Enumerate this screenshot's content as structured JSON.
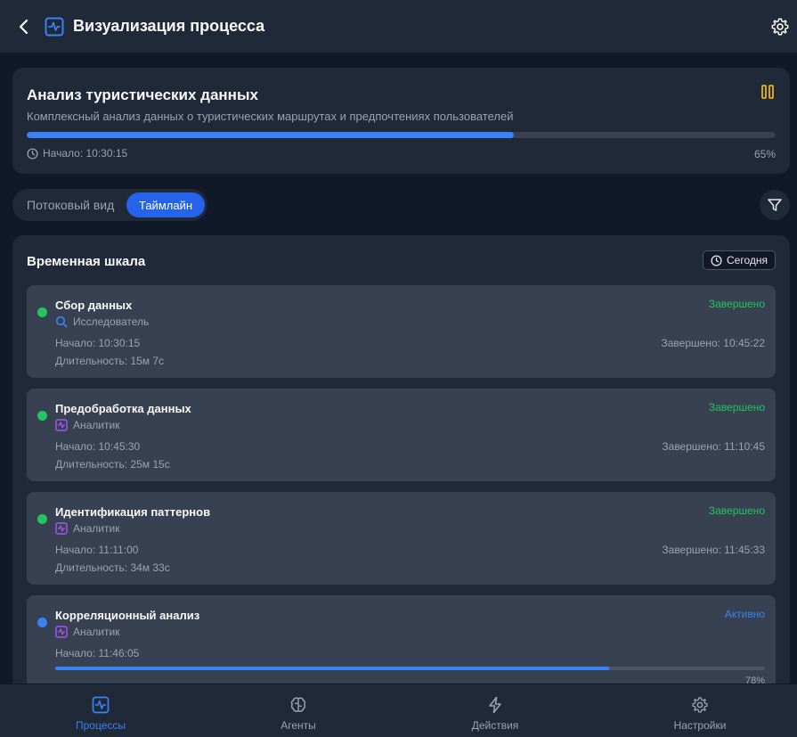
{
  "header": {
    "title": "Визуализация процесса"
  },
  "process": {
    "title": "Анализ туристических данных",
    "description": "Комплексный анализ данных о туристических маршрутах и предпочтениях пользователей",
    "progress": 0.65,
    "progress_label": "65%",
    "start_label": "Начало: 10:30:15"
  },
  "view_toggle": {
    "flow_label": "Потоковый вид",
    "timeline_label": "Таймлайн",
    "selected": "Таймлайн"
  },
  "timeline": {
    "title": "Временная шкала",
    "today_label": "Сегодня",
    "stages": [
      {
        "name": "Сбор данных",
        "agent": "Исследователь",
        "agent_icon": "search-icon",
        "status": "Завершено",
        "start": "Начало: 10:30:15",
        "end": "Завершено: 10:45:22",
        "duration": "Длительность: 15м 7с"
      },
      {
        "name": "Предобработка данных",
        "agent": "Аналитик",
        "agent_icon": "activity-icon",
        "status": "Завершено",
        "start": "Начало: 10:45:30",
        "end": "Завершено: 11:10:45",
        "duration": "Длительность: 25м 15с"
      },
      {
        "name": "Идентификация паттернов",
        "agent": "Аналитик",
        "agent_icon": "activity-icon",
        "status": "Завершено",
        "start": "Начало: 11:11:00",
        "end": "Завершено: 11:45:33",
        "duration": "Длительность: 34м 33с"
      },
      {
        "name": "Корреляционный анализ",
        "agent": "Аналитик",
        "agent_icon": "activity-icon",
        "status": "Активно",
        "start": "Начало: 11:46:05",
        "progress": 0.78,
        "progress_label": "78%"
      }
    ]
  },
  "nav": {
    "items": [
      {
        "label": "Процессы",
        "icon": "activity-icon",
        "active": true
      },
      {
        "label": "Агенты",
        "icon": "brain-icon",
        "active": false
      },
      {
        "label": "Действия",
        "icon": "lightning-icon",
        "active": false
      },
      {
        "label": "Настройки",
        "icon": "gear-icon",
        "active": false
      }
    ]
  },
  "colors": {
    "accent": "#3b82f6",
    "success": "#22c55e",
    "warning": "#eab308",
    "agent_analyst": "#a855f7",
    "background": "#111827",
    "card": "#1f2937"
  }
}
